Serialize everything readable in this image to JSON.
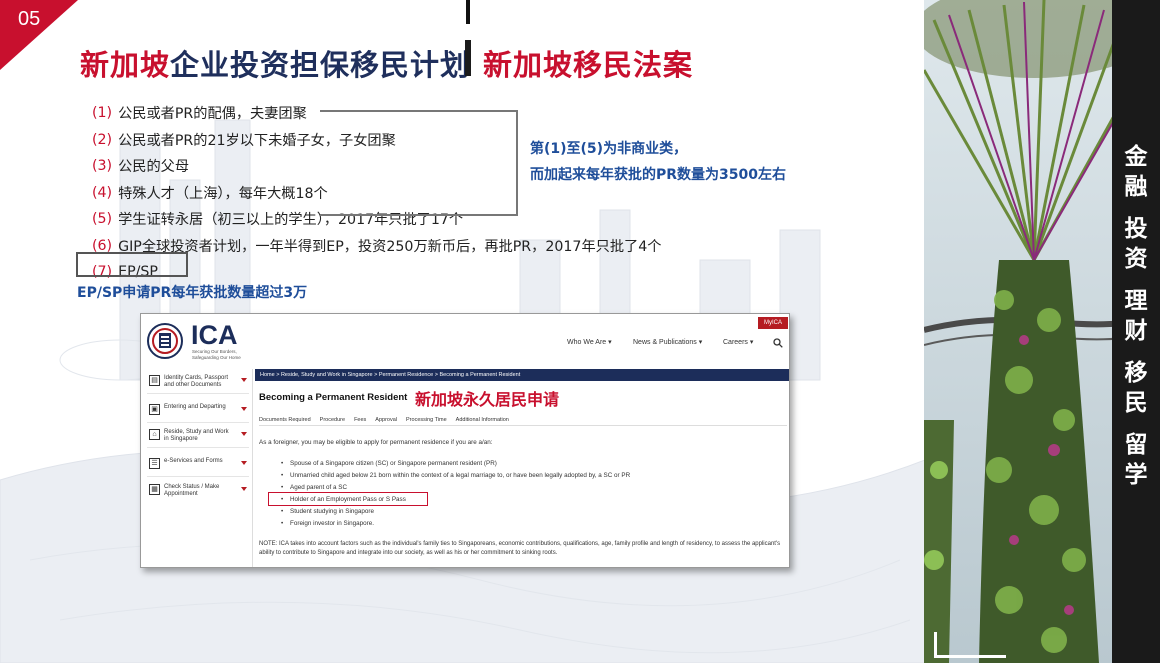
{
  "page": {
    "number": "05",
    "title_part1": "新加坡",
    "title_part2": "企业投资担保移民计划",
    "title_right": "新加坡移民法案"
  },
  "list": [
    {
      "num": "(1)",
      "text": "公民或者PR的配偶，夫妻团聚"
    },
    {
      "num": "(2)",
      "text": "公民或者PR的21岁以下未婚子女，子女团聚"
    },
    {
      "num": "(3)",
      "text": "公民的父母"
    },
    {
      "num": "(4)",
      "text": "特殊人才（上海），每年大概18个"
    },
    {
      "num": "(5)",
      "text": "学生证转永居（初三以上的学生），2017年只批了17个"
    },
    {
      "num": "(6)",
      "text": "GIP全球投资者计划，一年半得到EP，投资250万新币后，再批PR，2017年只批了4个"
    },
    {
      "num": "(7)",
      "text": "EP/SP"
    }
  ],
  "side_note": {
    "line1": "第(1)至(5)为非商业类，",
    "line2": "而加起来每年获批的PR数量为3500左右"
  },
  "ep_note": "EP/SP申请PR每年获批数量超过3万",
  "ica": {
    "brand": "ICA",
    "tagline": "Securing Our Borders, Safeguarding Our Home",
    "myica": "MyICA",
    "nav": [
      "Who We Are",
      "News & Publications",
      "Careers"
    ],
    "sidebar": [
      {
        "label": "Identity Cards, Passport and other Documents",
        "icon": "id-card-icon"
      },
      {
        "label": "Entering and Departing",
        "icon": "luggage-icon"
      },
      {
        "label": "Reside, Study and Work in Singapore",
        "icon": "home-icon"
      },
      {
        "label": "e-Services and Forms",
        "icon": "form-icon"
      },
      {
        "label": "Check Status / Make Appointment",
        "icon": "calendar-icon"
      }
    ],
    "breadcrumb": "Home > Reside, Study and Work in Singapore > Permanent Residence > Becoming a Permanent Resident",
    "heading": "Becoming a Permanent Resident",
    "overlay_label": "新加坡永久居民申请",
    "tabs": [
      "Documents Required",
      "Procedure",
      "Fees",
      "Approval",
      "Processing Time",
      "Additional Information"
    ],
    "intro": "As a foreigner, you may be eligible to apply for permanent residence if you are a/an:",
    "bullets": [
      "Spouse of a Singapore citizen (SC) or Singapore permanent resident (PR)",
      "Unmarried child aged below 21 born within the context of a legal marriage to, or have been legally adopted by, a SC or PR",
      "Aged parent of a SC",
      "Holder of an Employment Pass or S Pass",
      "Student studying in Singapore",
      "Foreign investor in Singapore."
    ],
    "note": "NOTE: ICA takes into account factors such as the individual's family ties to Singaporeans, economic contributions, qualifications, age, family profile and length of residency, to assess the applicant's ability to contribute to Singapore and integrate into our society, as well as his or her commitment to sinking roots."
  },
  "side_strip": [
    "金融",
    "投资",
    "理财",
    "移民",
    "留学"
  ],
  "colors": {
    "accent_red": "#c8102e",
    "navy": "#1f2f5c",
    "note_blue": "#1f4e9a"
  }
}
